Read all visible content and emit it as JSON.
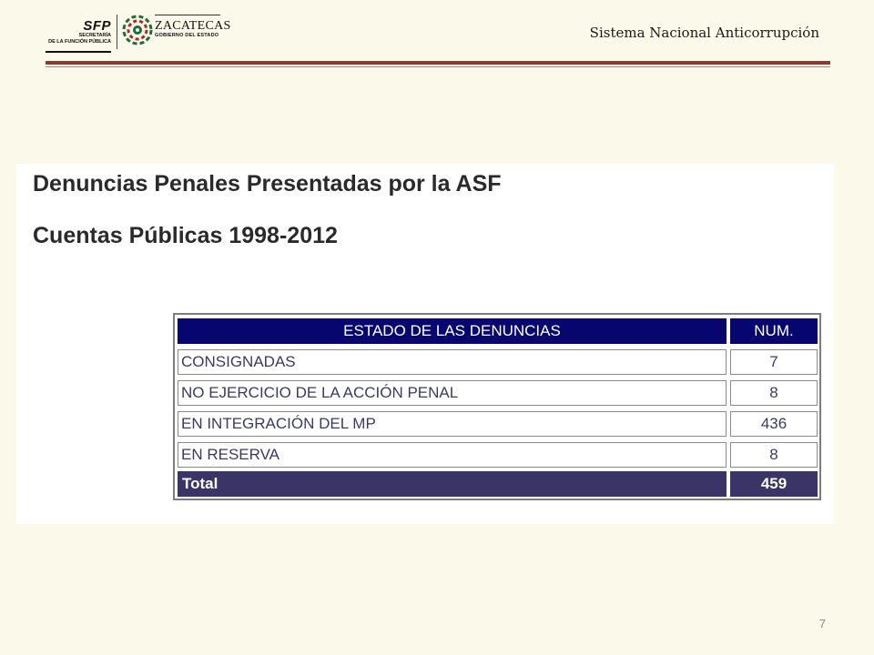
{
  "header": {
    "title": "Sistema Nacional Anticorrupción",
    "logos": {
      "sfp_title": "SFP",
      "sfp_subtitle": "SECRETARÍA\nDE LA FUNCIÓN PÚBLICA",
      "zacatecas_name": "ZACATECAS",
      "zacatecas_subtitle": "GOBIERNO DEL ESTADO",
      "emblem_icon": "zacatecas-emblem-icon"
    },
    "colors": {
      "rule": "#8a3a35"
    }
  },
  "slide": {
    "title_line1": "Denuncias Penales Presentadas por la ASF",
    "title_line2": "Cuentas Públicas 1998-2012"
  },
  "table": {
    "headers": [
      "ESTADO DE LAS DENUNCIAS",
      "NUM."
    ],
    "rows": [
      {
        "label": "CONSIGNADAS",
        "value": "7"
      },
      {
        "label": "NO EJERCICIO DE LA ACCIÓN PENAL",
        "value": "8"
      },
      {
        "label": "EN INTEGRACIÓN DEL MP",
        "value": "436"
      },
      {
        "label": "EN RESERVA",
        "value": "8"
      }
    ],
    "total": {
      "label": "Total",
      "value": "459"
    },
    "colors": {
      "header_bg": "#06066e",
      "total_bg": "#3a3566",
      "text": "#3a3a6a"
    }
  },
  "page_number": "7"
}
